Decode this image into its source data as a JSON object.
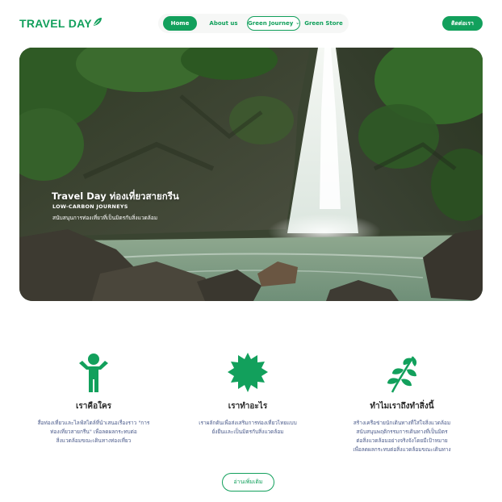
{
  "header": {
    "logo_text": "TRAVEL DAY",
    "logo_icon": "leaf-icon",
    "nav": [
      {
        "label": "Home",
        "active": true
      },
      {
        "label": "About us",
        "active": false
      },
      {
        "label": "Green Journey",
        "active": false,
        "has_dropdown": true
      },
      {
        "label": "Green Store",
        "active": false
      }
    ],
    "contact_label": "ติดต่อเรา"
  },
  "hero": {
    "title": "Travel Day ท่องเที่ยวสายกรีน",
    "subtitle": "LOW-CARBON JOURNEYS",
    "description": "สนับสนุนการท่องเที่ยวที่เป็นมิตรกับสิ่งแวดล้อม",
    "image_subject": "waterfall-forest"
  },
  "features": [
    {
      "icon": "person-icon",
      "title": "เราคือใคร",
      "lines": [
        "สื่อท่องเที่ยวและไลฟ์สไตล์ที่นำเสนอเรื่องราว \"การ",
        "ท่องเที่ยวสายกรีน\" เพื่อลดผลกระทบต่อ",
        "สิ่งแวดล้อมขณะเดินทางท่องเที่ยว"
      ]
    },
    {
      "icon": "badge-icon",
      "title": "เราทำอะไร",
      "lines": [
        "เราผลักดันเพื่อส่งเสริมการท่องเที่ยวไทยแบบ",
        "ยั่งยืนและเป็นมิตรกับสิ่งแวดล้อม"
      ]
    },
    {
      "icon": "plant-icon",
      "title": "ทำไมเราถึงทำสิ่งนี้",
      "lines": [
        "สร้างเครือข่ายนักเดินทางที่ใส่ใจสิ่งแวดล้อม",
        "สนับสนุนพฤติกรรมการเดินทางที่เป็นมิตร",
        "ต่อสิ่งแวดล้อมอย่างจริงจังโดยมีเป้าหมาย",
        "เพื่อลดผลกระทบต่อสิ่งแวดล้อมขณะเดินทาง"
      ]
    }
  ],
  "more_label": "อ่านเพิ่มเติม",
  "colors": {
    "brand": "#12a05c",
    "text": "#2a2a2a",
    "body_text": "#4a5a8a"
  }
}
